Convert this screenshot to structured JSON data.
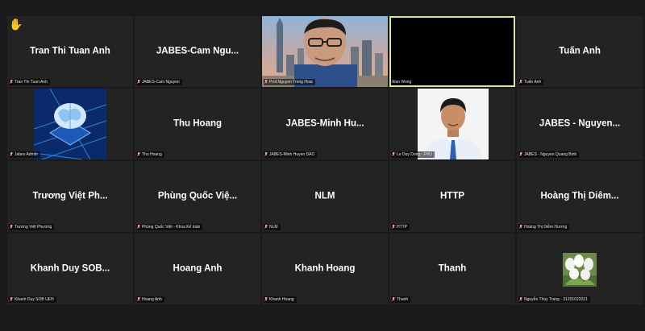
{
  "participants": [
    {
      "display": "Tran Thi Tuan Anh",
      "label": "Tran Thi Tuan Anh",
      "raised_hand": true
    },
    {
      "display": "JABES-Cam Ngu...",
      "label": "JABES-Cam Nguyen"
    },
    {
      "display": "",
      "label": "Prof.Nguyen Trong Hoai",
      "video": "person-city"
    },
    {
      "display": "",
      "label": "Alan Wong",
      "video": "black",
      "active_speaker": true
    },
    {
      "display": "Tuấn Anh",
      "label": "Tuấn Anh"
    },
    {
      "display": "",
      "label": "Jabes Admin",
      "video": "brain-chip"
    },
    {
      "display": "Thu Hoang",
      "label": "Thu Hoang"
    },
    {
      "display": "JABES-Minh Hu...",
      "label": "JABES-Minh Huyen DAO"
    },
    {
      "display": "",
      "label": "Le Duy Dong - FHU",
      "video": "portrait"
    },
    {
      "display": "JABES - Nguyen...",
      "label": "JABES - Nguyen Quang Binh"
    },
    {
      "display": "Trương Việt Ph...",
      "label": "Trương Việt Phương"
    },
    {
      "display": "Phùng Quốc Việ...",
      "label": "Phùng Quốc Việt - Khoa Kế toán"
    },
    {
      "display": "NLM",
      "label": "NLM"
    },
    {
      "display": "HTTP",
      "label": "HTTP"
    },
    {
      "display": "Hoàng Thị Diễm...",
      "label": "Hoàng Thị Diễm Hương"
    },
    {
      "display": "Khanh Duy SOB...",
      "label": "Khanh Duy SOB UEH"
    },
    {
      "display": "Hoang Anh",
      "label": "Hoang Anh"
    },
    {
      "display": "Khanh Hoang",
      "label": "Khanh Hoang"
    },
    {
      "display": "Thanh",
      "label": "Thanh"
    },
    {
      "display": "",
      "label": "Nguyễn Thùy Trang - 31201022021",
      "video": "flowers"
    }
  ],
  "icons": {
    "mic_muted": "mic-muted-icon",
    "raise_hand": "raised-hand-icon",
    "raise_hand_glyph": "✋"
  },
  "colors": {
    "background": "#1a1a1a",
    "tile": "#232323",
    "active_border": "#d8e89a",
    "muted_slash": "#e34b4b"
  }
}
